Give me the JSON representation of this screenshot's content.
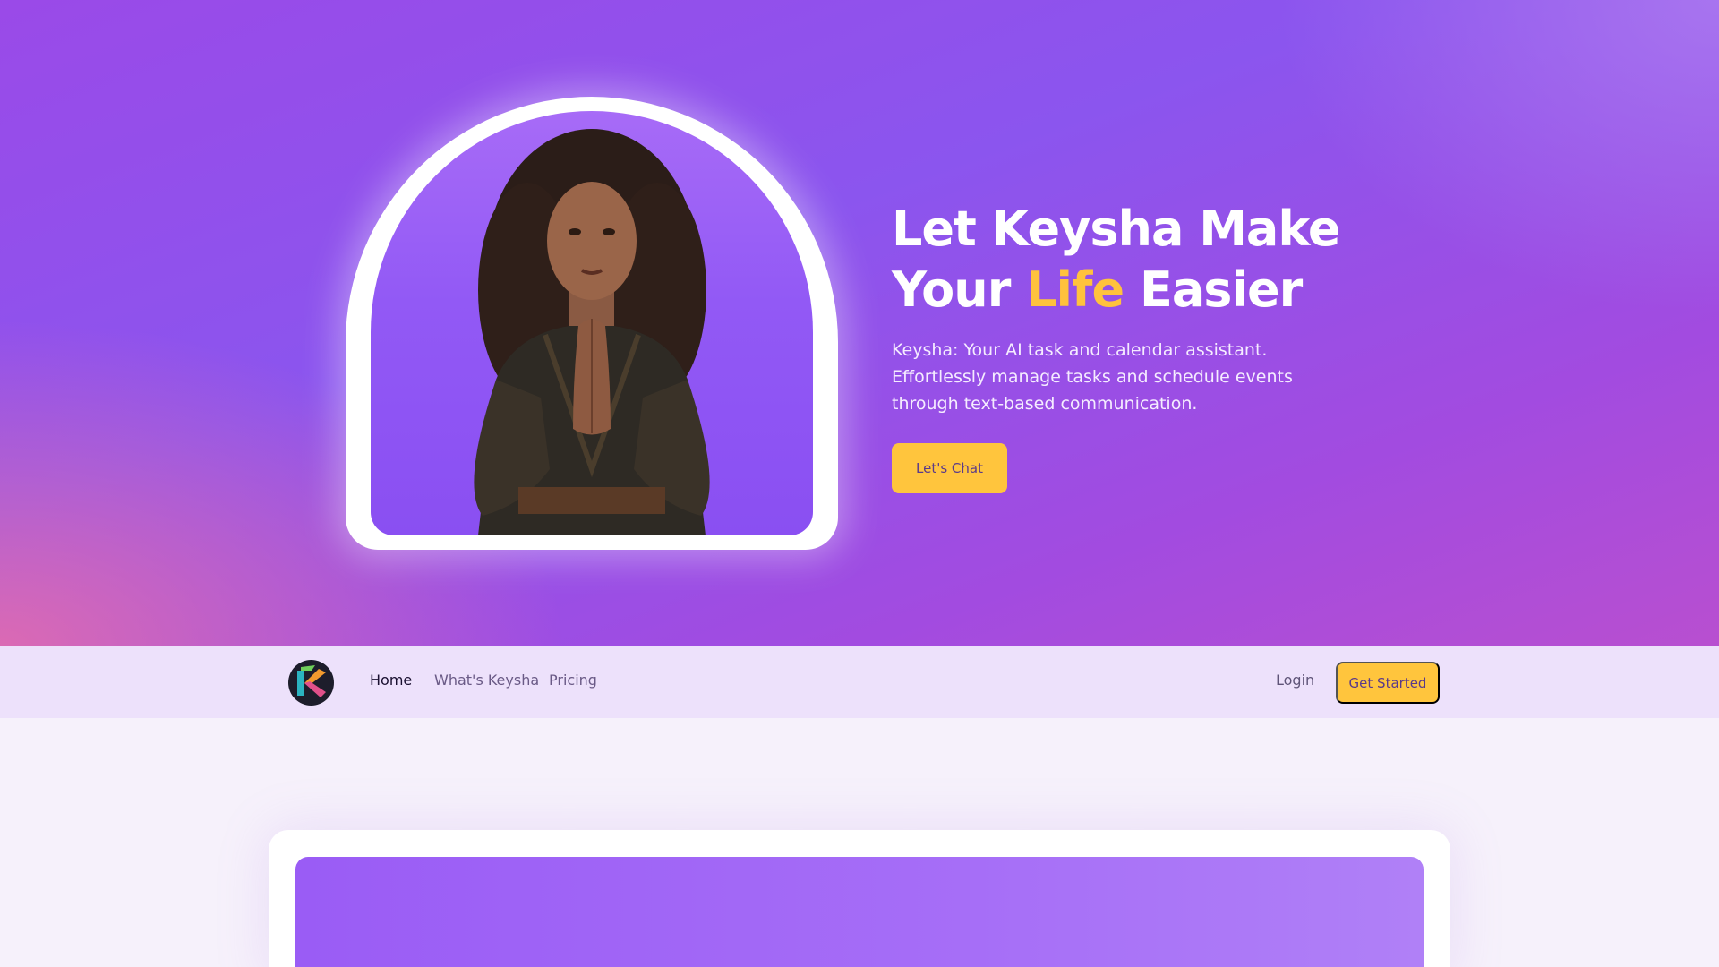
{
  "hero": {
    "headline_part1": "Let Keysha Make",
    "headline_part2a": "Your ",
    "headline_accent": "Life",
    "headline_part2b": " Easier",
    "subtext_line1": "Keysha: Your AI task and calendar assistant.",
    "subtext_line2": "Effortlessly manage tasks and schedule events",
    "subtext_line3": "through text-based communication.",
    "cta_label": "Let's Chat"
  },
  "nav": {
    "items": [
      {
        "label": "Home",
        "active": true
      },
      {
        "label": "What's Keysha",
        "active": false
      },
      {
        "label": "Pricing",
        "active": false
      }
    ],
    "login_label": "Login",
    "get_started_label": "Get Started"
  },
  "colors": {
    "accent": "#ffc23d",
    "hero_purple": "#8b55ee",
    "nav_bg": "#ede1fb"
  },
  "icons": {
    "logo": "keysha-k-logo-icon"
  }
}
